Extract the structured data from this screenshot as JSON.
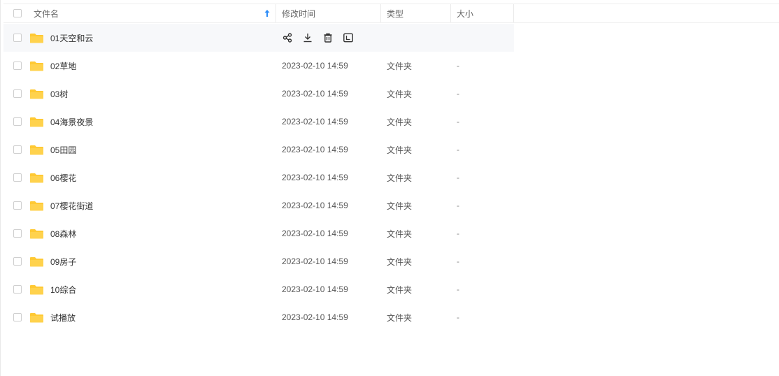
{
  "header": {
    "name_label": "文件名",
    "modified_label": "修改时间",
    "type_label": "类型",
    "size_label": "大小",
    "sort_field": "文件名",
    "sort_order": "ascending"
  },
  "colors": {
    "folder": "#ffc933",
    "sort_arrow": "#2b8cf8",
    "hover_row": "#f7f8fa"
  },
  "icons": {
    "hover_actions": [
      "share-icon",
      "download-icon",
      "delete-icon",
      "rename-icon"
    ]
  },
  "rows": [
    {
      "name": "01天空和云",
      "modified": "",
      "type": "",
      "size": "",
      "hovered": true
    },
    {
      "name": "02草地",
      "modified": "2023-02-10 14:59",
      "type": "文件夹",
      "size": "-"
    },
    {
      "name": "03树",
      "modified": "2023-02-10 14:59",
      "type": "文件夹",
      "size": "-"
    },
    {
      "name": "04海景夜景",
      "modified": "2023-02-10 14:59",
      "type": "文件夹",
      "size": "-"
    },
    {
      "name": "05田园",
      "modified": "2023-02-10 14:59",
      "type": "文件夹",
      "size": "-"
    },
    {
      "name": "06樱花",
      "modified": "2023-02-10 14:59",
      "type": "文件夹",
      "size": "-"
    },
    {
      "name": "07樱花街道",
      "modified": "2023-02-10 14:59",
      "type": "文件夹",
      "size": "-"
    },
    {
      "name": "08森林",
      "modified": "2023-02-10 14:59",
      "type": "文件夹",
      "size": "-"
    },
    {
      "name": "09房子",
      "modified": "2023-02-10 14:59",
      "type": "文件夹",
      "size": "-"
    },
    {
      "name": "10综合",
      "modified": "2023-02-10 14:59",
      "type": "文件夹",
      "size": "-"
    },
    {
      "name": "试播放",
      "modified": "2023-02-10 14:59",
      "type": "文件夹",
      "size": "-"
    }
  ]
}
